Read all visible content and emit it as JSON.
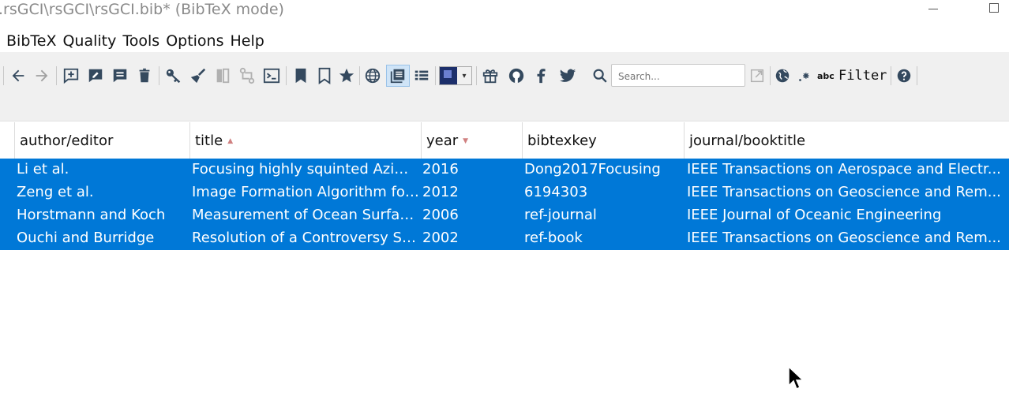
{
  "window": {
    "title": ".rsGCI\\rsGCI\\rsGCI.bib* (BibTeX mode)"
  },
  "menu": [
    "BibTeX",
    "Quality",
    "Tools",
    "Options",
    "Help"
  ],
  "toolbar": {
    "search_placeholder": "Search...",
    "abc_label": "abc",
    "filter_label": "Filter",
    "icons": [
      "arrow-left-icon",
      "arrow-right-icon",
      "add-comment-icon",
      "edit-comment-icon",
      "comment-icon",
      "trash-icon",
      "key-icon",
      "broom-icon",
      "merge-icon",
      "diff-icon",
      "terminal-icon",
      "bookmark-icon",
      "bookmark-outline-icon",
      "star-icon",
      "globe-icon",
      "view-list-icon",
      "list-icon",
      "theme-icon",
      "gift-icon",
      "github-icon",
      "facebook-icon",
      "twitter-icon",
      "search-icon",
      "external-link-icon",
      "world-icon",
      "sparkle-icon",
      "help-icon"
    ]
  },
  "table": {
    "columns": [
      {
        "label": "author/editor",
        "sort": ""
      },
      {
        "label": "title",
        "sort": "asc"
      },
      {
        "label": "year",
        "sort": "desc"
      },
      {
        "label": "bibtexkey",
        "sort": ""
      },
      {
        "label": "journal/booktitle",
        "sort": ""
      }
    ],
    "rows": [
      {
        "author": "Li et al.",
        "title": "Focusing highly squinted Azimu...",
        "year": "2016",
        "key": "Dong2017Focusing",
        "journal": "IEEE Transactions on Aerospace and Electr..."
      },
      {
        "author": "Zeng et al.",
        "title": "Image Formation Algorithm for...",
        "year": "2012",
        "key": "6194303",
        "journal": "IEEE Transactions on Geoscience and Rem..."
      },
      {
        "author": "Horstmann and Koch",
        "title": "Measurement of Ocean Surfac...",
        "year": "2006",
        "key": "ref-journal",
        "journal": "IEEE Journal of Oceanic Engineering"
      },
      {
        "author": "Ouchi and Burridge",
        "title": "Resolution of a Controversy Su...",
        "year": "2002",
        "key": "ref-book",
        "journal": "IEEE Transactions on Geoscience and Rem..."
      }
    ]
  },
  "colors": {
    "selection": "#0078d7",
    "icon": "#34495e"
  }
}
